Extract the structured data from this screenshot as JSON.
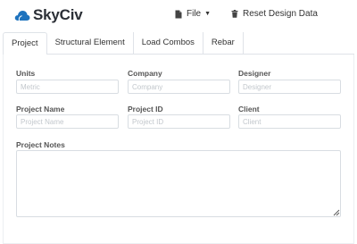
{
  "app": {
    "brand": "SkyCiv"
  },
  "header": {
    "file_label": "File",
    "reset_label": "Reset Design Data"
  },
  "tabs": [
    {
      "label": "Project",
      "active": true
    },
    {
      "label": "Structural Element",
      "active": false
    },
    {
      "label": "Load Combos",
      "active": false
    },
    {
      "label": "Rebar",
      "active": false
    }
  ],
  "form": {
    "units": {
      "label": "Units",
      "placeholder": "Metric"
    },
    "company": {
      "label": "Company",
      "placeholder": "Company"
    },
    "designer": {
      "label": "Designer",
      "placeholder": "Designer"
    },
    "project_name": {
      "label": "Project Name",
      "placeholder": "Project Name"
    },
    "project_id": {
      "label": "Project ID",
      "placeholder": "Project ID"
    },
    "client": {
      "label": "Client",
      "placeholder": "Client"
    },
    "project_notes": {
      "label": "Project Notes",
      "value": ""
    }
  },
  "colors": {
    "logo_cloud": "#1e73be",
    "text": "#333333",
    "border": "#d8dde2"
  }
}
